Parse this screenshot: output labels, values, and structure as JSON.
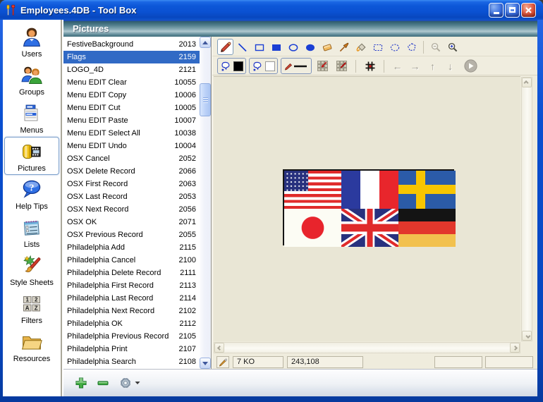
{
  "window": {
    "title": "Employees.4DB - Tool Box"
  },
  "titlebar": {
    "buttons": [
      "minimize",
      "maximize",
      "close"
    ]
  },
  "header": {
    "title": "Pictures"
  },
  "sidebar": {
    "selected": "Pictures",
    "items": [
      {
        "label": "Users",
        "icon": "users"
      },
      {
        "label": "Groups",
        "icon": "groups"
      },
      {
        "label": "Menus",
        "icon": "menus"
      },
      {
        "label": "Pictures",
        "icon": "pictures",
        "selected": true
      },
      {
        "label": "Help Tips",
        "icon": "help-tips",
        "icon_text": "?"
      },
      {
        "label": "Lists",
        "icon": "lists"
      },
      {
        "label": "Style Sheets",
        "icon": "style-sheets"
      },
      {
        "label": "Filters",
        "icon": "filters",
        "icon_text": "12AZ"
      },
      {
        "label": "Resources",
        "icon": "resources"
      }
    ]
  },
  "picture_list": {
    "selected": "Flags",
    "items": [
      {
        "name": "FestiveBackground",
        "id": "2013"
      },
      {
        "name": "Flags",
        "id": "2159",
        "selected": true
      },
      {
        "name": "LOGO_4D",
        "id": "2121"
      },
      {
        "name": "Menu EDIT Clear",
        "id": "10055"
      },
      {
        "name": "Menu EDIT Copy",
        "id": "10006"
      },
      {
        "name": "Menu EDIT Cut",
        "id": "10005"
      },
      {
        "name": "Menu EDIT Paste",
        "id": "10007"
      },
      {
        "name": "Menu EDIT Select All",
        "id": "10038"
      },
      {
        "name": "Menu EDIT Undo",
        "id": "10004"
      },
      {
        "name": "OSX Cancel",
        "id": "2052"
      },
      {
        "name": "OSX Delete Record",
        "id": "2066"
      },
      {
        "name": "OSX First Record",
        "id": "2063"
      },
      {
        "name": "OSX Last Record",
        "id": "2053"
      },
      {
        "name": "OSX Next Record",
        "id": "2056"
      },
      {
        "name": "OSX OK",
        "id": "2071"
      },
      {
        "name": "OSX Previous Record",
        "id": "2055"
      },
      {
        "name": "Philadelphia Add",
        "id": "2115"
      },
      {
        "name": "Philadelphia Cancel",
        "id": "2100"
      },
      {
        "name": "Philadelphia Delete Record",
        "id": "2111"
      },
      {
        "name": "Philadelphia First Record",
        "id": "2113"
      },
      {
        "name": "Philadelphia Last Record",
        "id": "2114"
      },
      {
        "name": "Philadelphia Next Record",
        "id": "2102"
      },
      {
        "name": "Philadelphia OK",
        "id": "2112"
      },
      {
        "name": "Philadelphia Previous Record",
        "id": "2105"
      },
      {
        "name": "Philadelphia Print",
        "id": "2107"
      },
      {
        "name": "Philadelphia Search",
        "id": "2108"
      }
    ]
  },
  "toolbar": {
    "row1": [
      {
        "tool": "pencil",
        "selected": true
      },
      {
        "tool": "line"
      },
      {
        "tool": "rect"
      },
      {
        "tool": "rect-filled"
      },
      {
        "tool": "oval"
      },
      {
        "tool": "oval-filled"
      },
      {
        "tool": "eraser"
      },
      {
        "tool": "eyedropper"
      },
      {
        "tool": "paint-bucket"
      },
      {
        "tool": "select-rect"
      },
      {
        "tool": "select-oval"
      },
      {
        "tool": "select-lasso"
      },
      {
        "sep": true
      },
      {
        "tool": "zoom-out"
      },
      {
        "tool": "zoom-in"
      }
    ],
    "row2": [
      {
        "tool": "foreground-color",
        "swatch": "#000000",
        "framed": true
      },
      {
        "tool": "background-color",
        "swatch": "#ffffff",
        "framed": true
      },
      {
        "tool": "line-style",
        "framed": true
      },
      {
        "tool": "grid-zoom"
      },
      {
        "tool": "grid-draw"
      },
      {
        "sep": true
      },
      {
        "tool": "grid-toggle"
      },
      {
        "sep": true
      },
      {
        "tool": "nudge-left",
        "glyph": "←",
        "disabled": true
      },
      {
        "tool": "nudge-right",
        "glyph": "→",
        "disabled": true
      },
      {
        "tool": "nudge-up",
        "glyph": "↑",
        "disabled": true
      },
      {
        "tool": "nudge-down",
        "glyph": "↓",
        "disabled": true
      },
      {
        "tool": "play"
      }
    ]
  },
  "preview": {
    "name": "Flags",
    "flags": [
      "usa",
      "france",
      "sweden",
      "japan",
      "uk",
      "germany"
    ]
  },
  "statusbar": {
    "file_size": "7 KO",
    "dimensions": "243,108"
  },
  "bottom_actions": [
    "add",
    "remove",
    "settings"
  ],
  "colors": {
    "selection_blue": "#316ac5",
    "titlebar_blue": "#0a51d2",
    "header_teal": "#3c6a79",
    "pane_beige": "#ece9d8",
    "toolbar_icon_blue": "#1b3fd4"
  }
}
